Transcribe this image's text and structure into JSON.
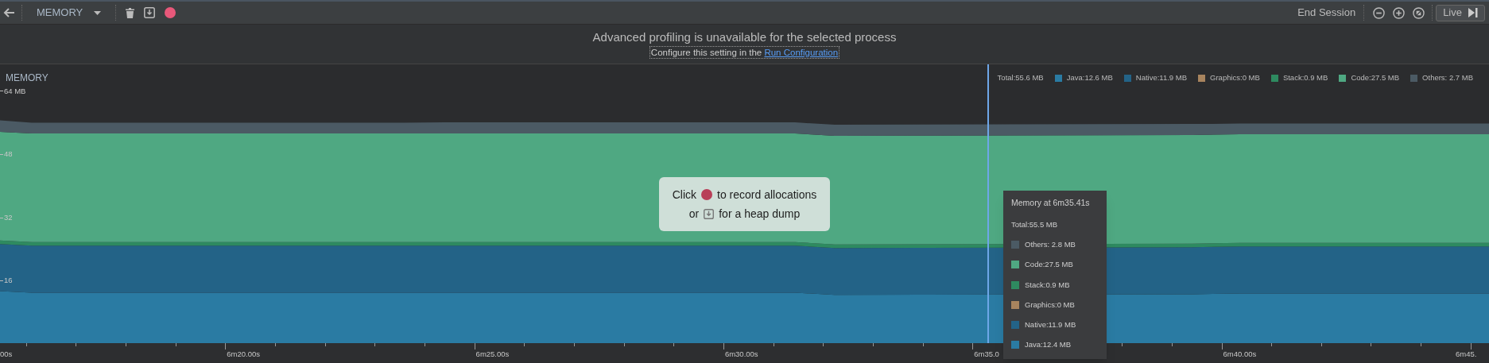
{
  "toolbar": {
    "profiler": "MEMORY",
    "end_session": "End Session",
    "live": "Live"
  },
  "banner": {
    "title": "Advanced profiling is unavailable for the selected process",
    "message": "Configure this setting in the ",
    "link": "Run Configuration"
  },
  "memory_panel": {
    "title": "MEMORY",
    "total": "Total:55.6 MB",
    "legend": [
      {
        "label": "Java:12.6 MB",
        "color": "#2a7ba3"
      },
      {
        "label": "Native:11.9 MB",
        "color": "#236387"
      },
      {
        "label": "Graphics:0 MB",
        "color": "#a8845e"
      },
      {
        "label": "Stack:0.9 MB",
        "color": "#2e8a60"
      },
      {
        "label": "Code:27.5 MB",
        "color": "#4fa882"
      },
      {
        "label": "Others: 2.7 MB",
        "color": "#4b5a64"
      }
    ],
    "y_axis": [
      "64 MB",
      "48",
      "32",
      "16"
    ],
    "time_axis": [
      "00s",
      "6m20.00s",
      "6m25.00s",
      "6m30.00s",
      "6m35.0",
      "6m40.00s",
      "6m45."
    ],
    "hint": {
      "lines": [
        {
          "before": "Click",
          "kind": "record",
          "after": "to record allocations"
        },
        {
          "before": "or",
          "kind": "heap-dump",
          "after": "for a heap dump"
        }
      ]
    },
    "tooltip": {
      "title": "Memory at 6m35.41s",
      "total": "Total:55.5 MB",
      "items": [
        {
          "label": "Others: 2.8 MB",
          "color": "#4b5a64"
        },
        {
          "label": "Code:27.5 MB",
          "color": "#4fa882"
        },
        {
          "label": "Stack:0.9 MB",
          "color": "#2e8a60"
        },
        {
          "label": "Graphics:0 MB",
          "color": "#a8845e"
        },
        {
          "label": "Native:11.9 MB",
          "color": "#236387"
        },
        {
          "label": "Java:12.4 MB",
          "color": "#2a7ba3"
        }
      ]
    }
  }
}
